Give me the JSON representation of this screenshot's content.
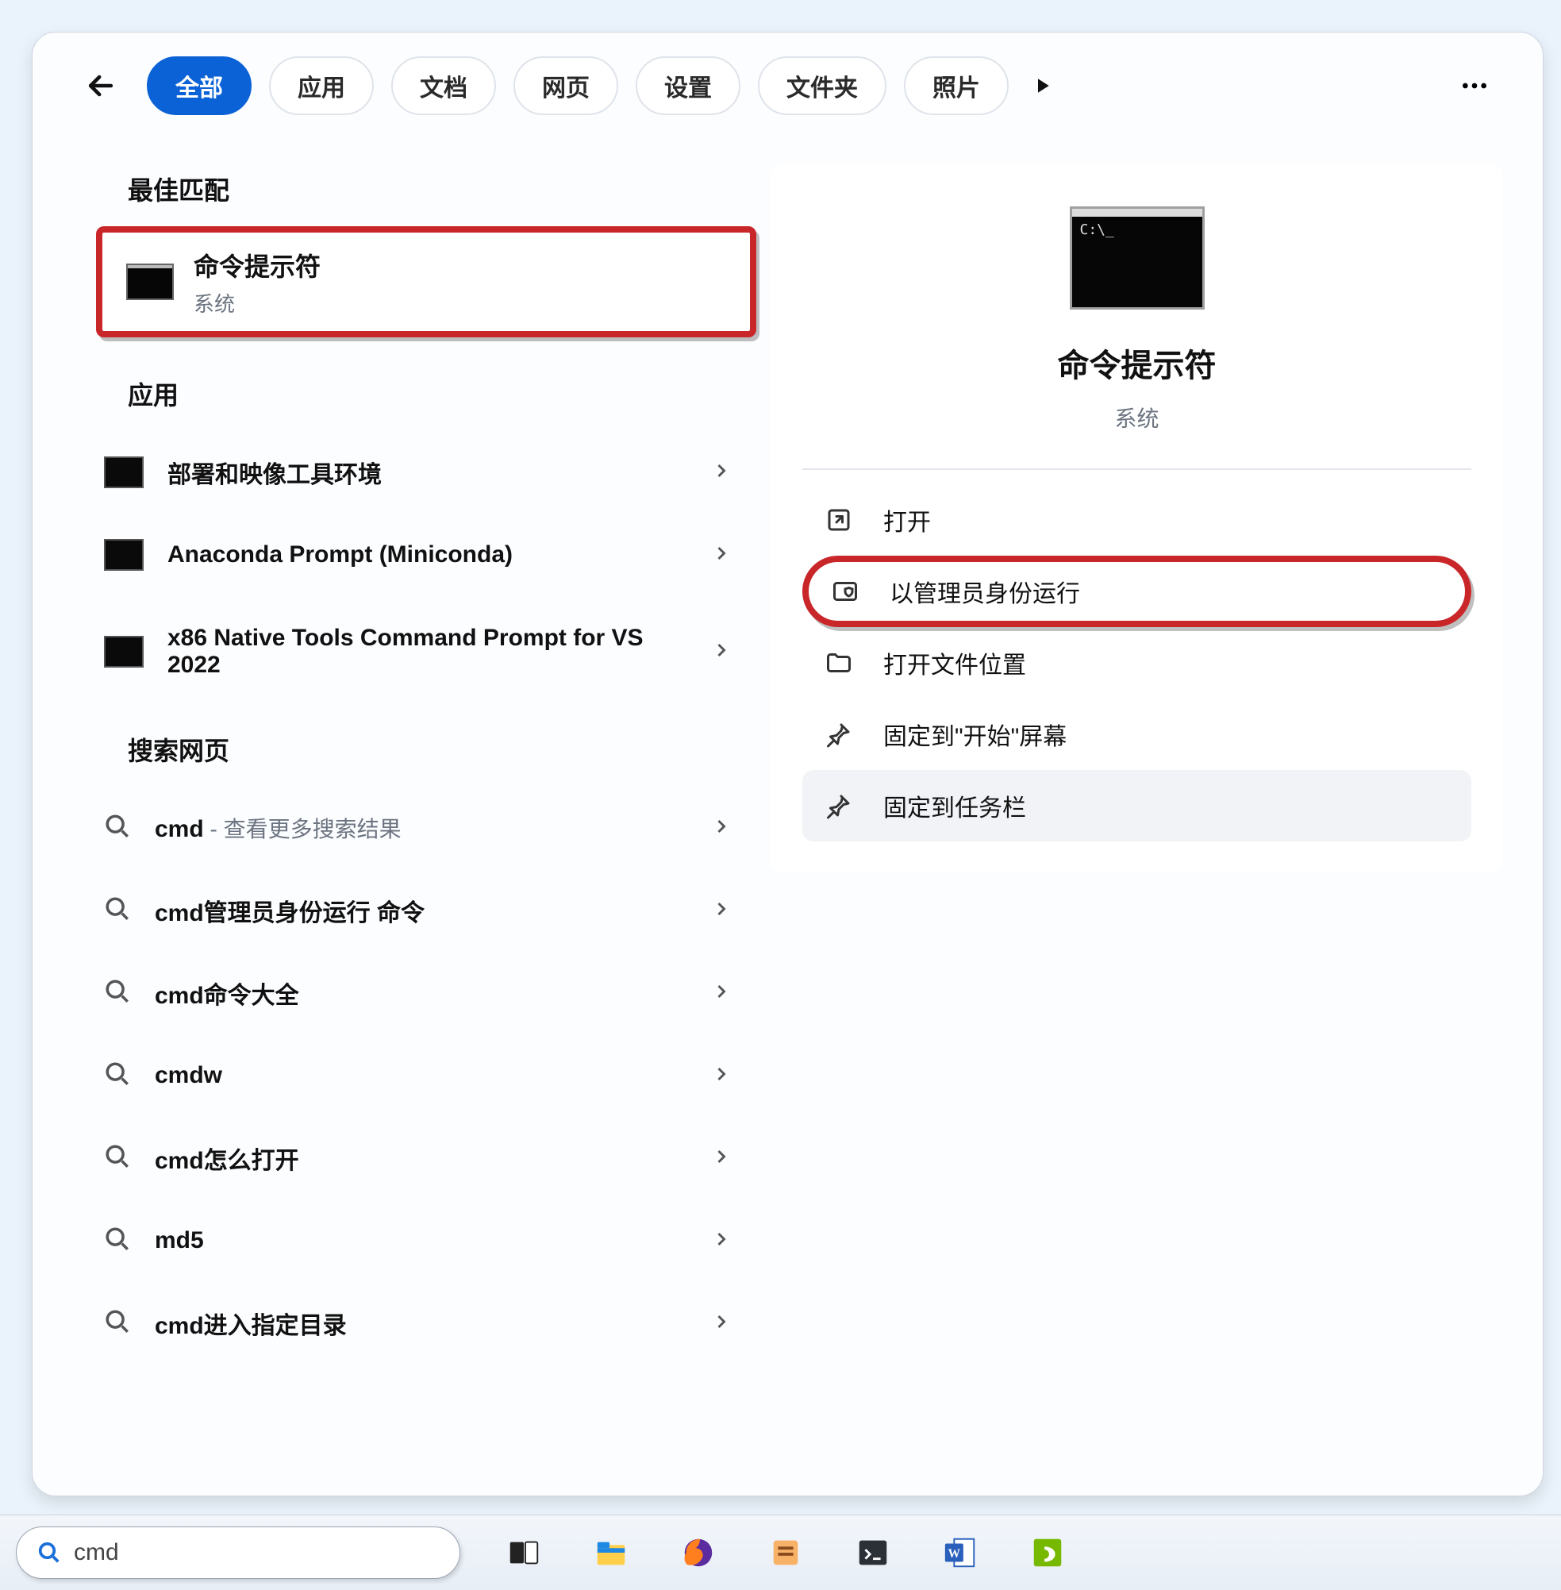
{
  "filters": {
    "back_icon": "back",
    "chips": [
      "全部",
      "应用",
      "文档",
      "网页",
      "设置",
      "文件夹",
      "照片"
    ],
    "active_index": 0
  },
  "sections": {
    "best_match": "最佳匹配",
    "apps": "应用",
    "web": "搜索网页"
  },
  "best_match_item": {
    "title": "命令提示符",
    "subtitle": "系统"
  },
  "apps": [
    {
      "label": "部署和映像工具环境"
    },
    {
      "label": "Anaconda Prompt (Miniconda)"
    },
    {
      "label": "x86 Native Tools Command Prompt for VS 2022"
    }
  ],
  "web": [
    {
      "term": "cmd",
      "suffix": " - 查看更多搜索结果"
    },
    {
      "term": "cmd管理员身份运行 命令",
      "suffix": ""
    },
    {
      "term": "cmd命令大全",
      "suffix": ""
    },
    {
      "term": "cmdw",
      "suffix": ""
    },
    {
      "term": "cmd怎么打开",
      "suffix": ""
    },
    {
      "term": "md5",
      "suffix": ""
    },
    {
      "term": "cmd进入指定目录",
      "suffix": ""
    }
  ],
  "details": {
    "title": "命令提示符",
    "subtitle": "系统",
    "caret": "C:\\_",
    "actions": [
      {
        "icon": "open",
        "label": "打开"
      },
      {
        "icon": "admin",
        "label": "以管理员身份运行"
      },
      {
        "icon": "folder",
        "label": "打开文件位置"
      },
      {
        "icon": "pin",
        "label": "固定到\"开始\"屏幕"
      },
      {
        "icon": "pin",
        "label": "固定到任务栏"
      }
    ],
    "highlight_index": 1,
    "hover_index": 4
  },
  "taskbar": {
    "query": "cmd",
    "icons": [
      "taskview",
      "explorer",
      "firefox",
      "notes",
      "terminal",
      "word",
      "nvidia"
    ]
  }
}
